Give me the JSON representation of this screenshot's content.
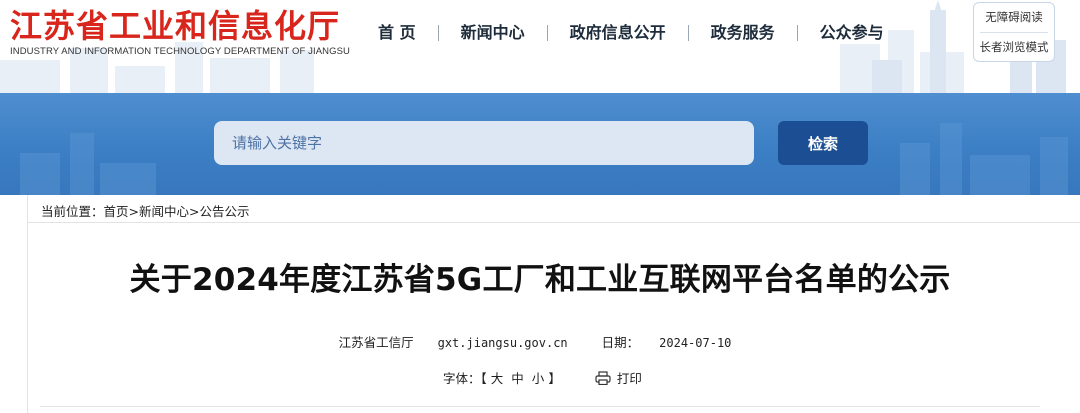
{
  "site": {
    "title_cn": "江苏省工业和信息化厅",
    "title_en": "INDUSTRY AND INFORMATION TECHNOLOGY DEPARTMENT OF JIANGSU"
  },
  "nav": [
    {
      "label": "首 页"
    },
    {
      "label": "新闻中心"
    },
    {
      "label": "政府信息公开"
    },
    {
      "label": "政务服务"
    },
    {
      "label": "公众参与"
    }
  ],
  "accessibility": {
    "barrier_free": "无障碍阅读",
    "elder_mode": "长者浏览模式"
  },
  "search": {
    "placeholder": "请输入关键字",
    "button": "检索"
  },
  "breadcrumb": {
    "prefix": "当前位置：",
    "items": [
      "首页",
      "新闻中心",
      "公告公示"
    ],
    "separator": ">"
  },
  "article": {
    "title": "关于2024年度江苏省5G工厂和工业互联网平台名单的公示",
    "source": "江苏省工信厅",
    "site": "gxt.jiangsu.gov.cn",
    "date_label": "日期：",
    "date": "2024-07-10"
  },
  "tools": {
    "font_label": "字体：【",
    "large": "大",
    "medium": "中",
    "small": "小",
    "close": "】",
    "print": "打印"
  },
  "colors": {
    "brand_red": "#d8261c",
    "band_blue": "#3c7fc4",
    "button_navy": "#1c4e93"
  },
  "icons": [
    "printer-icon"
  ]
}
